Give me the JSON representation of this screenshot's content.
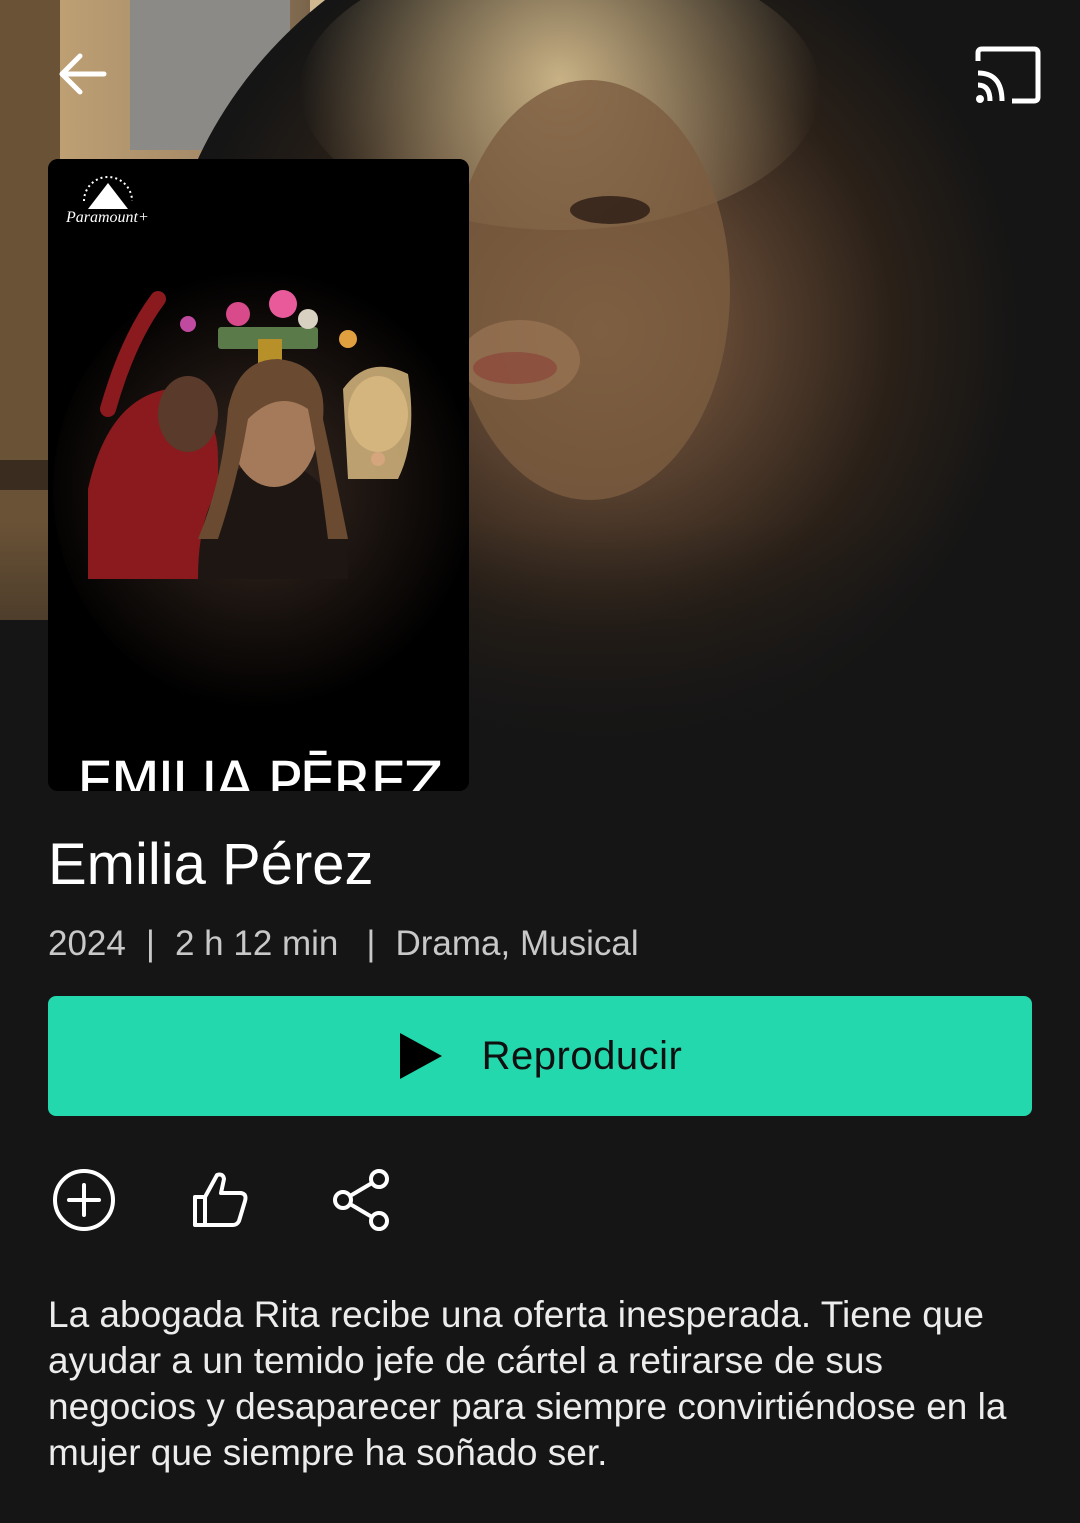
{
  "header": {
    "back_icon": "arrow-left-icon",
    "cast_icon": "cast-icon"
  },
  "poster": {
    "brand": "Paramount+",
    "title_art": "EMILIA PĒREZ"
  },
  "movie": {
    "title": "Emilia Pérez",
    "year": "2024",
    "duration": "2 h 12 min",
    "genres": "Drama, Musical",
    "separator": "|",
    "description": "La abogada Rita recibe una oferta inesperada. Tiene que ayudar a un temido jefe de cártel a retirarse de sus negocios y desaparecer para siempre convirtiéndose en la mujer que siempre ha soñado ser."
  },
  "play_button": {
    "label": "Reproducir",
    "icon": "play-icon",
    "color": "#22d8ac"
  },
  "actions": [
    {
      "icon": "add-circle-icon"
    },
    {
      "icon": "thumbs-up-icon"
    },
    {
      "icon": "share-icon"
    }
  ],
  "colors": {
    "background": "#151515",
    "accent": "#22d8ac"
  }
}
